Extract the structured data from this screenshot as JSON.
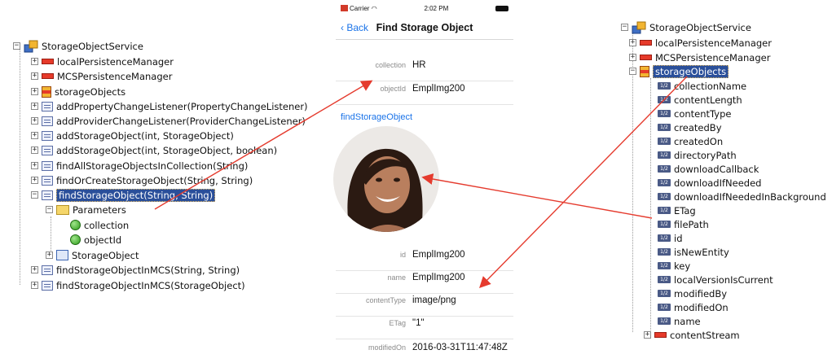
{
  "left_tree": {
    "root": "StorageObjectService",
    "items": [
      "localPersistenceManager",
      "MCSPersistenceManager",
      "storageObjects",
      "addPropertyChangeListener(PropertyChangeListener)",
      "addProviderChangeListener(ProviderChangeListener)",
      "addStorageObject(int, StorageObject)",
      "addStorageObject(int, StorageObject, boolean)",
      "findAllStorageObjectsInCollection(String)",
      "findOrCreateStorageObject(String, String)",
      "findStorageObject(String, String)",
      "Parameters",
      "collection",
      "objectId",
      "StorageObject",
      "findStorageObjectInMCS(String, String)",
      "findStorageObjectInMCS(StorageObject)"
    ]
  },
  "phone": {
    "status_carrier": "Carrier",
    "status_time": "2:02 PM",
    "back_label": "Back",
    "title": "Find Storage Object",
    "collection_label": "collection",
    "collection_value": "HR",
    "objectid_label": "objectId",
    "objectid_value": "EmplImg200",
    "section_label": "findStorageObject",
    "fields": [
      {
        "label": "id",
        "value": "EmplImg200"
      },
      {
        "label": "name",
        "value": "EmplImg200"
      },
      {
        "label": "contentType",
        "value": "image/png"
      },
      {
        "label": "ETag",
        "value": "\"1\""
      },
      {
        "label": "modifiedOn",
        "value": "2016-03-31T11:47:48Z"
      }
    ]
  },
  "right_tree": {
    "root": "StorageObjectService",
    "items": [
      "localPersistenceManager",
      "MCSPersistenceManager",
      "storageObjects",
      "collectionName",
      "contentLength",
      "contentType",
      "createdBy",
      "createdOn",
      "directoryPath",
      "downloadCallback",
      "downloadIfNeeded",
      "downloadIfNeededInBackground",
      "ETag",
      "filePath",
      "id",
      "isNewEntity",
      "key",
      "localVersionIsCurrent",
      "modifiedBy",
      "modifiedOn",
      "name",
      "contentStream"
    ]
  },
  "colors": {
    "selection": "#2a4f9a",
    "arrow": "#e53b2e",
    "ios_blue": "#1a73e8"
  }
}
